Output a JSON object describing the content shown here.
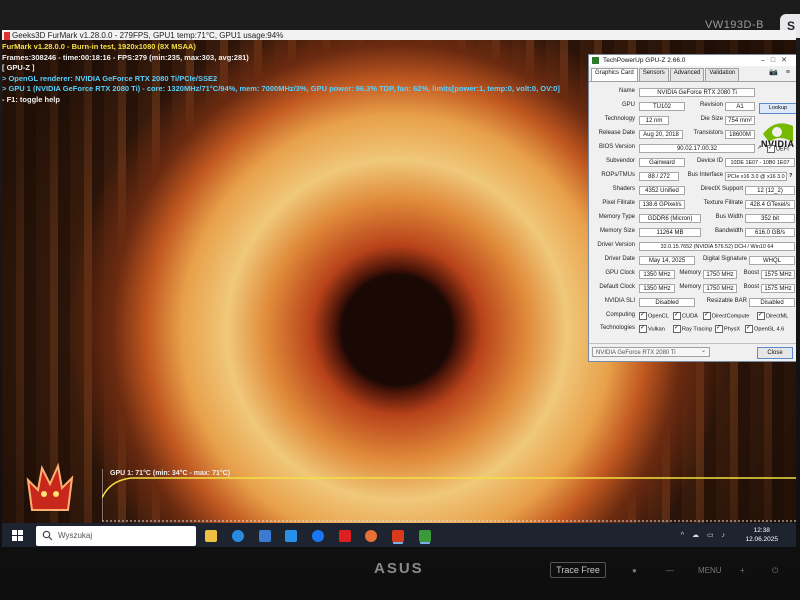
{
  "monitor": {
    "model": "VW193D-B",
    "brand": "ASUS",
    "splendid": "Trace Free",
    "menu_label": "MENU",
    "tail": "S"
  },
  "furmark": {
    "window_title": "Geeks3D FurMark v1.28.0.0 - 279FPS, GPU1 temp:71°C, GPU1 usage:94%",
    "lines": [
      {
        "text": "FurMark v1.28.0.0 - Burn-in test, 1920x1080 (8X MSAA)",
        "color": "y"
      },
      {
        "text": "Frames:308246 - time:00:18:16 - FPS:279 (min:235, max:303, avg:281)",
        "color": "w"
      },
      {
        "text": "[ GPU-Z ]",
        "color": "w"
      },
      {
        "text": "> OpenGL renderer: NVIDIA GeForce RTX 2080 Ti/PCIe/SSE2",
        "color": "c"
      },
      {
        "text": "> GPU 1 (NVIDIA GeForce RTX 2080 Ti) - core: 1320MHz/71°C/94%, mem: 7000MHz/3%, GPU power: 96.3% TDP, fan: 62%, limits[power:1, temp:0, volt:0, OV:0]",
        "color": "c"
      },
      {
        "text": "- F1: toggle help",
        "color": "w"
      }
    ],
    "graph_label": "GPU 1: 71°C (min: 34°C - max: 71°C)"
  },
  "gpuz": {
    "title": "TechPowerUp GPU-Z 2.66.0",
    "tabs": [
      "Graphics Card",
      "Sensors",
      "Advanced",
      "Validation"
    ],
    "lookup": "Lookup",
    "vendor_logo": "NVIDIA",
    "fields": {
      "name_label": "Name",
      "name": "NVIDIA GeForce RTX 2080 Ti",
      "gpu_label": "GPU",
      "gpu": "TU102",
      "revision_label": "Revision",
      "revision": "A1",
      "technology_label": "Technology",
      "technology": "12 nm",
      "diesize_label": "Die Size",
      "diesize": "754 mm²",
      "release_label": "Release Date",
      "release": "Aug 20, 2018",
      "transistors_label": "Transistors",
      "transistors": "18600M",
      "bios_label": "BIOS Version",
      "bios": "90.02.17.00.32",
      "uefi": "UEFI",
      "subvendor_label": "Subvendor",
      "subvendor": "Gainward",
      "deviceid_label": "Device ID",
      "deviceid": "10DE 1E07 - 10B0 1E07",
      "rops_label": "ROPs/TMUs",
      "rops": "88 / 272",
      "busif_label": "Bus Interface",
      "busif": "PCIe x16 3.0 @ x16 3.0",
      "q": "?",
      "shaders_label": "Shaders",
      "shaders": "4352 Unified",
      "dx_label": "DirectX Support",
      "dx": "12 (12_2)",
      "pixel_label": "Pixel Fillrate",
      "pixel": "138.6 GPixel/s",
      "texture_label": "Texture Fillrate",
      "texture": "428.4 GTexel/s",
      "memtype_label": "Memory Type",
      "memtype": "GDDR6 (Micron)",
      "buswidth_label": "Bus Width",
      "buswidth": "352 bit",
      "memsize_label": "Memory Size",
      "memsize": "11264 MB",
      "bandwidth_label": "Bandwidth",
      "bandwidth": "616.0 GB/s",
      "driver_label": "Driver Version",
      "driver": "32.0.15.7652 (NVIDIA 576.52) DCH / Win10 64",
      "driverdate_label": "Driver Date",
      "driverdate": "May 14, 2025",
      "digsig_label": "Digital Signature",
      "digsig": "WHQL",
      "gpuclock_label": "GPU Clock",
      "gpuclock": "1350 MHz",
      "memory_label": "Memory",
      "mem1": "1750 MHz",
      "boost_label": "Boost",
      "boost1": "1575 MHz",
      "defclock_label": "Default Clock",
      "defclock": "1350 MHz",
      "mem2": "1750 MHz",
      "boost2": "1575 MHz",
      "sli_label": "NVIDIA SLI",
      "sli": "Disabled",
      "rebar_label": "Resizable BAR",
      "rebar": "Disabled",
      "computing_label": "Computing",
      "technologies_label": "Technologies"
    },
    "computing": [
      "OpenCL",
      "CUDA",
      "DirectCompute",
      "DirectML"
    ],
    "technologies": [
      "Vulkan",
      "Ray Tracing",
      "PhysX",
      "OpenGL 4.6"
    ],
    "device_select": "NVIDIA GeForce RTX 2080 Ti",
    "close": "Close"
  },
  "taskbar": {
    "search_placeholder": "Wyszukaj",
    "time": "12:38",
    "date": "12.06.2025"
  },
  "colors": {
    "taskbar": "#1d2430",
    "nvidia_green": "#76b900",
    "graph_line": "#f4e040"
  }
}
